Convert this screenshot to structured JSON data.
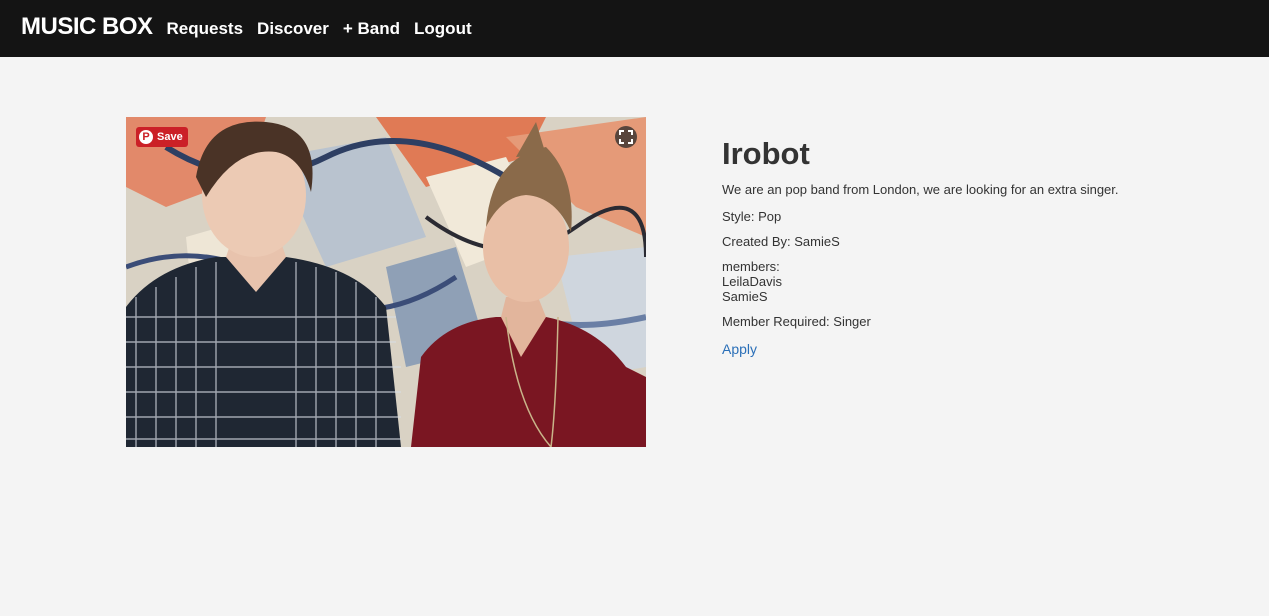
{
  "nav": {
    "brand": "MUSIC BOX",
    "links": [
      "Requests",
      "Discover",
      "+ Band",
      "Logout"
    ]
  },
  "photo": {
    "pin_save_label": "Save",
    "pin_logo": "P",
    "expand_icon": "expand-icon"
  },
  "band": {
    "name": "Irobot",
    "description": "We are an pop band from London, we are looking for an extra singer.",
    "style": "Style: Pop",
    "created_by": "Created By: SamieS",
    "members_label": "members:",
    "members": [
      "LeilaDavis",
      "SamieS"
    ],
    "member_required": "Member Required: Singer",
    "apply_label": "Apply"
  },
  "colors": {
    "navbar": "#141414",
    "background": "#f4f4f4",
    "link": "#2a6fb8",
    "pinterest": "#cb2027"
  }
}
